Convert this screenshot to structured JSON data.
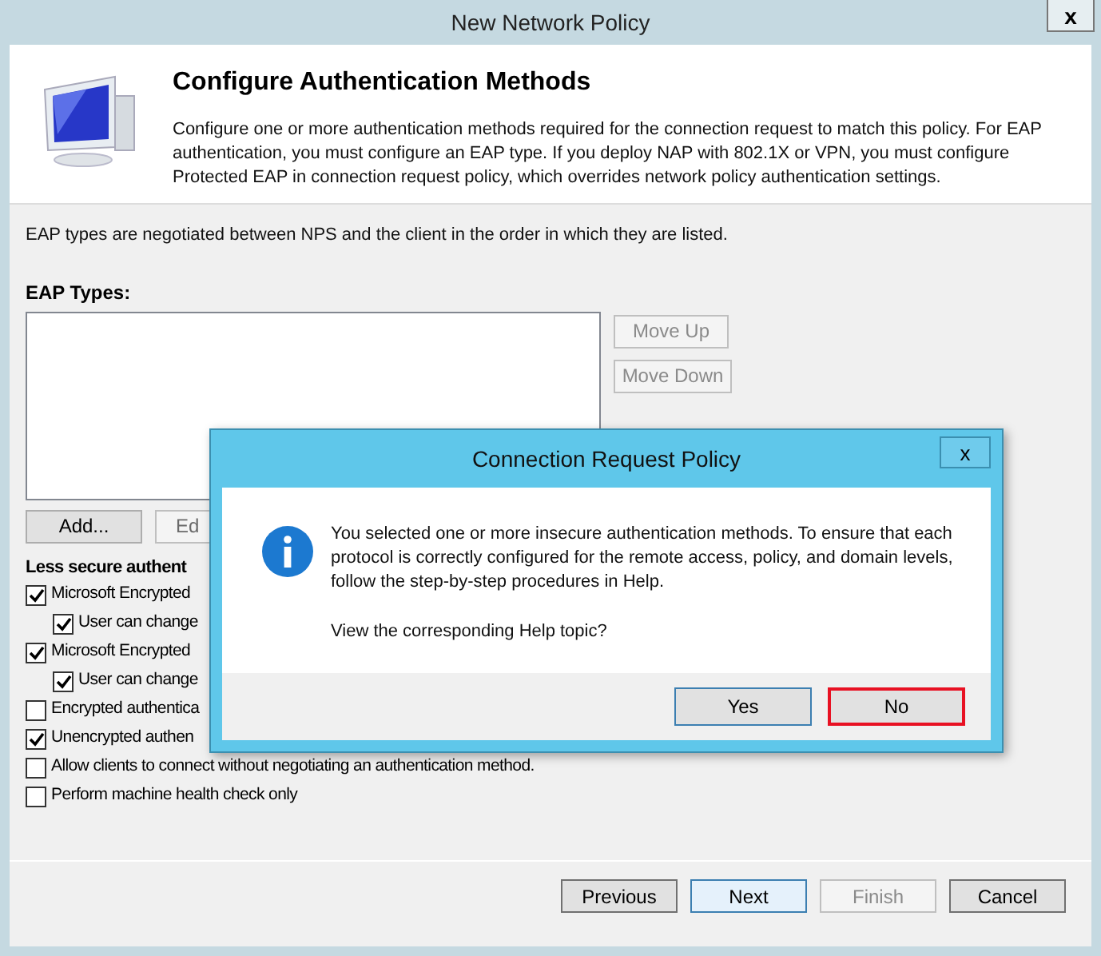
{
  "window": {
    "title": "New Network Policy",
    "close": "x"
  },
  "header": {
    "title": "Configure Authentication Methods",
    "description": "Configure one or more authentication methods required for the connection request to match this policy. For EAP authentication, you must configure an EAP type. If you deploy NAP with 802.1X or VPN, you must configure Protected EAP in connection request policy, which overrides network policy authentication settings."
  },
  "intro": "EAP types are negotiated between NPS and the client in the order in which they are listed.",
  "eap_types": {
    "label": "EAP Types:",
    "move_up": "Move Up",
    "move_down": "Move Down",
    "add": "Add...",
    "edit": "Ed"
  },
  "less_secure": {
    "label": "Less secure authent",
    "items": [
      {
        "label": "Microsoft Encrypted",
        "checked": true,
        "children": [
          {
            "label": "User can change",
            "checked": true
          }
        ]
      },
      {
        "label": "Microsoft Encrypted",
        "checked": true,
        "children": [
          {
            "label": "User can change",
            "checked": true
          }
        ]
      },
      {
        "label": "Encrypted authentica",
        "checked": false
      },
      {
        "label": "Unencrypted authen",
        "checked": true
      },
      {
        "label": "Allow clients to connect without negotiating an authentication method.",
        "checked": false
      },
      {
        "label": "Perform machine health check only",
        "checked": false
      }
    ]
  },
  "footer_buttons": [
    {
      "label": "Previous",
      "disabled": false,
      "selected": false
    },
    {
      "label": "Next",
      "disabled": false,
      "selected": true
    },
    {
      "label": "Finish",
      "disabled": true,
      "selected": false
    },
    {
      "label": "Cancel",
      "disabled": false,
      "selected": false
    }
  ],
  "dialog": {
    "title": "Connection Request Policy",
    "close": "x",
    "message": "You selected one or more insecure authentication methods. To ensure that each protocol is correctly configured for the remote access, policy, and domain levels, follow the step-by-step procedures in Help.",
    "question": "View the corresponding Help topic?",
    "buttons": [
      {
        "label": "Yes",
        "selected": false
      },
      {
        "label": "No",
        "selected": true
      }
    ]
  }
}
